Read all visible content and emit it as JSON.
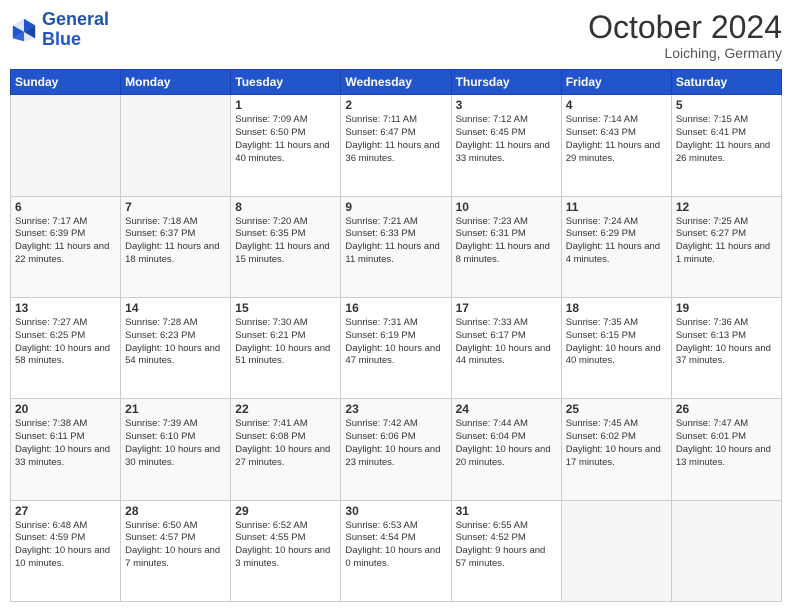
{
  "header": {
    "logo_line1": "General",
    "logo_line2": "Blue",
    "month": "October 2024",
    "location": "Loiching, Germany"
  },
  "weekdays": [
    "Sunday",
    "Monday",
    "Tuesday",
    "Wednesday",
    "Thursday",
    "Friday",
    "Saturday"
  ],
  "weeks": [
    [
      {
        "day": "",
        "info": ""
      },
      {
        "day": "",
        "info": ""
      },
      {
        "day": "1",
        "info": "Sunrise: 7:09 AM\nSunset: 6:50 PM\nDaylight: 11 hours and 40 minutes."
      },
      {
        "day": "2",
        "info": "Sunrise: 7:11 AM\nSunset: 6:47 PM\nDaylight: 11 hours and 36 minutes."
      },
      {
        "day": "3",
        "info": "Sunrise: 7:12 AM\nSunset: 6:45 PM\nDaylight: 11 hours and 33 minutes."
      },
      {
        "day": "4",
        "info": "Sunrise: 7:14 AM\nSunset: 6:43 PM\nDaylight: 11 hours and 29 minutes."
      },
      {
        "day": "5",
        "info": "Sunrise: 7:15 AM\nSunset: 6:41 PM\nDaylight: 11 hours and 26 minutes."
      }
    ],
    [
      {
        "day": "6",
        "info": "Sunrise: 7:17 AM\nSunset: 6:39 PM\nDaylight: 11 hours and 22 minutes."
      },
      {
        "day": "7",
        "info": "Sunrise: 7:18 AM\nSunset: 6:37 PM\nDaylight: 11 hours and 18 minutes."
      },
      {
        "day": "8",
        "info": "Sunrise: 7:20 AM\nSunset: 6:35 PM\nDaylight: 11 hours and 15 minutes."
      },
      {
        "day": "9",
        "info": "Sunrise: 7:21 AM\nSunset: 6:33 PM\nDaylight: 11 hours and 11 minutes."
      },
      {
        "day": "10",
        "info": "Sunrise: 7:23 AM\nSunset: 6:31 PM\nDaylight: 11 hours and 8 minutes."
      },
      {
        "day": "11",
        "info": "Sunrise: 7:24 AM\nSunset: 6:29 PM\nDaylight: 11 hours and 4 minutes."
      },
      {
        "day": "12",
        "info": "Sunrise: 7:25 AM\nSunset: 6:27 PM\nDaylight: 11 hours and 1 minute."
      }
    ],
    [
      {
        "day": "13",
        "info": "Sunrise: 7:27 AM\nSunset: 6:25 PM\nDaylight: 10 hours and 58 minutes."
      },
      {
        "day": "14",
        "info": "Sunrise: 7:28 AM\nSunset: 6:23 PM\nDaylight: 10 hours and 54 minutes."
      },
      {
        "day": "15",
        "info": "Sunrise: 7:30 AM\nSunset: 6:21 PM\nDaylight: 10 hours and 51 minutes."
      },
      {
        "day": "16",
        "info": "Sunrise: 7:31 AM\nSunset: 6:19 PM\nDaylight: 10 hours and 47 minutes."
      },
      {
        "day": "17",
        "info": "Sunrise: 7:33 AM\nSunset: 6:17 PM\nDaylight: 10 hours and 44 minutes."
      },
      {
        "day": "18",
        "info": "Sunrise: 7:35 AM\nSunset: 6:15 PM\nDaylight: 10 hours and 40 minutes."
      },
      {
        "day": "19",
        "info": "Sunrise: 7:36 AM\nSunset: 6:13 PM\nDaylight: 10 hours and 37 minutes."
      }
    ],
    [
      {
        "day": "20",
        "info": "Sunrise: 7:38 AM\nSunset: 6:11 PM\nDaylight: 10 hours and 33 minutes."
      },
      {
        "day": "21",
        "info": "Sunrise: 7:39 AM\nSunset: 6:10 PM\nDaylight: 10 hours and 30 minutes."
      },
      {
        "day": "22",
        "info": "Sunrise: 7:41 AM\nSunset: 6:08 PM\nDaylight: 10 hours and 27 minutes."
      },
      {
        "day": "23",
        "info": "Sunrise: 7:42 AM\nSunset: 6:06 PM\nDaylight: 10 hours and 23 minutes."
      },
      {
        "day": "24",
        "info": "Sunrise: 7:44 AM\nSunset: 6:04 PM\nDaylight: 10 hours and 20 minutes."
      },
      {
        "day": "25",
        "info": "Sunrise: 7:45 AM\nSunset: 6:02 PM\nDaylight: 10 hours and 17 minutes."
      },
      {
        "day": "26",
        "info": "Sunrise: 7:47 AM\nSunset: 6:01 PM\nDaylight: 10 hours and 13 minutes."
      }
    ],
    [
      {
        "day": "27",
        "info": "Sunrise: 6:48 AM\nSunset: 4:59 PM\nDaylight: 10 hours and 10 minutes."
      },
      {
        "day": "28",
        "info": "Sunrise: 6:50 AM\nSunset: 4:57 PM\nDaylight: 10 hours and 7 minutes."
      },
      {
        "day": "29",
        "info": "Sunrise: 6:52 AM\nSunset: 4:55 PM\nDaylight: 10 hours and 3 minutes."
      },
      {
        "day": "30",
        "info": "Sunrise: 6:53 AM\nSunset: 4:54 PM\nDaylight: 10 hours and 0 minutes."
      },
      {
        "day": "31",
        "info": "Sunrise: 6:55 AM\nSunset: 4:52 PM\nDaylight: 9 hours and 57 minutes."
      },
      {
        "day": "",
        "info": ""
      },
      {
        "day": "",
        "info": ""
      }
    ]
  ]
}
